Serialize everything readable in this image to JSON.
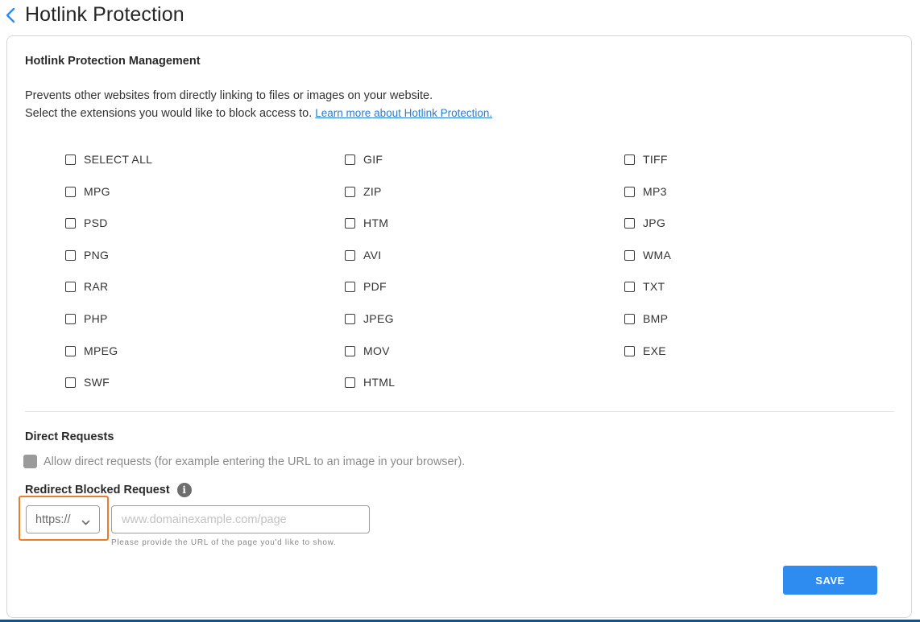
{
  "header": {
    "title": "Hotlink Protection"
  },
  "management": {
    "title": "Hotlink Protection Management",
    "description_line1": "Prevents other websites from directly linking to files or images on your website.",
    "description_line2": "Select the extensions you would like to block access to.",
    "learn_more": "Learn more about Hotlink Protection."
  },
  "extensions": {
    "column1": [
      "SELECT ALL",
      "MPG",
      "PSD",
      "PNG",
      "RAR",
      "PHP",
      "MPEG",
      "SWF"
    ],
    "column2": [
      "GIF",
      "ZIP",
      "HTM",
      "AVI",
      "PDF",
      "JPEG",
      "MOV",
      "HTML"
    ],
    "column3": [
      "TIFF",
      "MP3",
      "JPG",
      "WMA",
      "TXT",
      "BMP",
      "EXE"
    ]
  },
  "direct_requests": {
    "title": "Direct Requests",
    "toggle_label": "Allow direct requests (for example entering the URL to an image in your browser)."
  },
  "redirect": {
    "title": "Redirect Blocked Request",
    "protocol_value": "https://",
    "url_placeholder": "www.domainexample.com/page",
    "helper": "Please provide the URL of the page you'd like to show."
  },
  "actions": {
    "save_label": "SAVE"
  },
  "colors": {
    "accent": "#2e8cf0",
    "link": "#2a7dd6",
    "highlight": "#f07a2a"
  }
}
